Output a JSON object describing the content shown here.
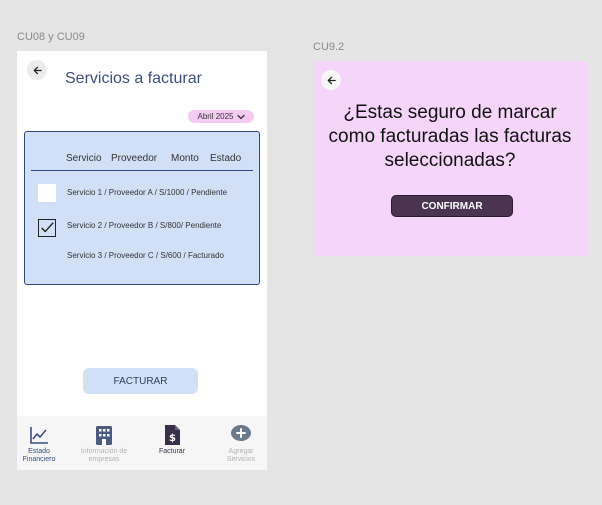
{
  "frames": {
    "left_label": "CU08 y CU09",
    "right_label": "CU9.2"
  },
  "screen": {
    "title": "Servicios a facturar",
    "month_selector": "Abril 2025",
    "table": {
      "headers": [
        "Servicio",
        "Proveedor",
        "Monto",
        "Estado"
      ],
      "rows": [
        {
          "text": "Servicio 1  /  Proveedor A   /  S/1000  /  Pendiente",
          "checkbox": "unchecked"
        },
        {
          "text": "Servicio 2   /  Proveedor B  /   S/800/  Pendiente",
          "checkbox": "checked"
        },
        {
          "text": "Servicio 3  /  Proveedor C   /  S/600  /  Facturado",
          "checkbox": "none"
        }
      ]
    },
    "facturar_button": "FACTURAR",
    "bottom_nav": [
      {
        "icon": "line-chart-icon",
        "label_1": "Estado",
        "label_2": "Financiero",
        "color": "#3a4f86"
      },
      {
        "icon": "building-icon",
        "label_1": "Información de",
        "label_2": "empresas",
        "color": "#b3b3b3"
      },
      {
        "icon": "invoice-dollar-icon",
        "label_1": "Facturar",
        "label_2": "",
        "color": "#3a2f4a"
      },
      {
        "icon": "plus-circle-icon",
        "label_1": "Agregar",
        "label_2": "Servicios",
        "color": "#b3b3b3"
      }
    ]
  },
  "dialog": {
    "message": "¿Estas seguro de marcar como facturadas las facturas seleccionadas?",
    "confirm_button": "CONFIRMAR"
  },
  "colors": {
    "accent_blue": "#3a4f86",
    "panel_blue": "#d2e0f7",
    "dialog_pink": "#f5d5fa",
    "confirm_purple": "#4a3450",
    "month_pill_pink": "#f5cbf3"
  }
}
